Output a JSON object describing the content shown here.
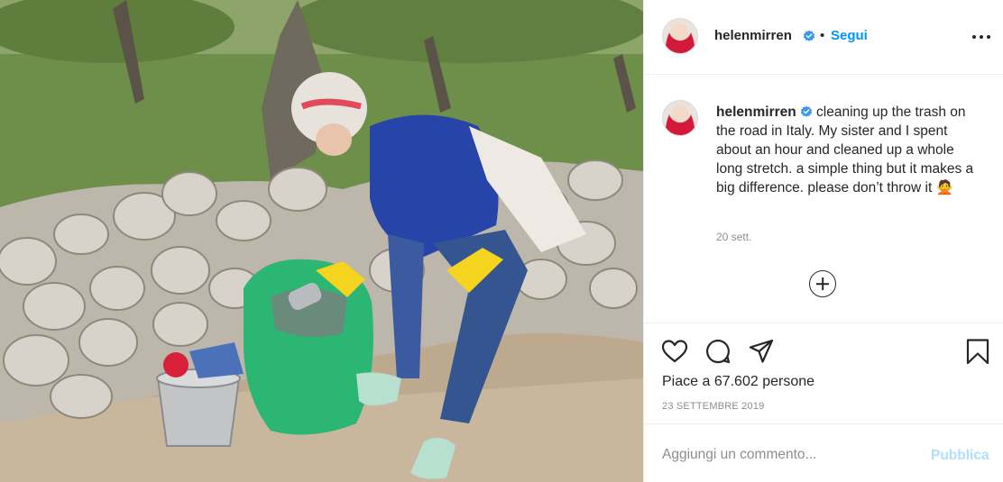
{
  "post": {
    "photo_alt": "helenmirren post photo",
    "colors": {
      "accent": "#0095f6",
      "publish_disabled": "#b2dffc",
      "verified": "#3897f0",
      "text": "#262626",
      "muted": "#8e8e8e"
    }
  },
  "header": {
    "username": "helenmirren",
    "separator": "•",
    "follow_label": "Segui"
  },
  "caption": {
    "username": "helenmirren",
    "text": "cleaning up the trash on the road in Italy. My sister and I spent about an hour and cleaned up a whole long stretch. a simple thing but it makes a big difference. please don’t throw it 🙅",
    "relative_date": "20 sett."
  },
  "actions": {
    "icons": [
      "heart-icon",
      "comment-icon",
      "share-icon",
      "bookmark-icon"
    ],
    "likes_text": "Piace a 67.602 persone",
    "date": "23 SETTEMBRE 2019"
  },
  "comment": {
    "placeholder": "Aggiungi un commento...",
    "publish_label": "Pubblica"
  }
}
